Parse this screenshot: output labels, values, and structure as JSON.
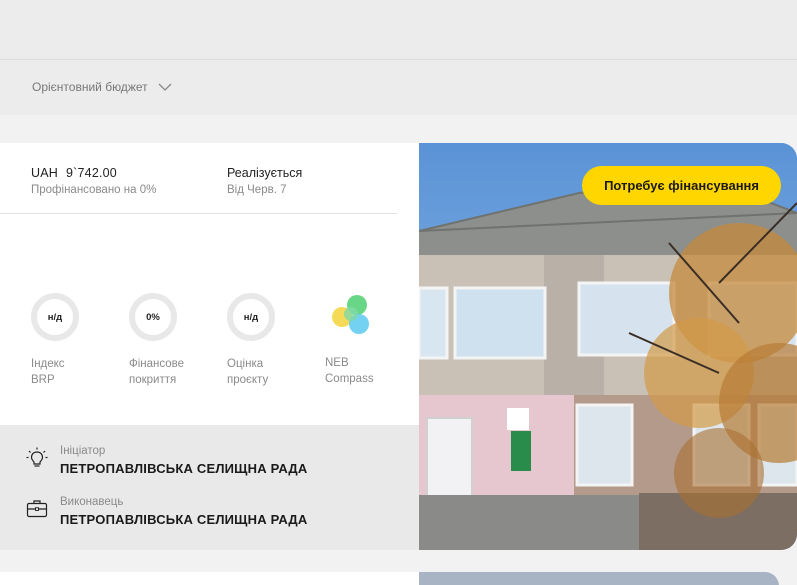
{
  "filter": {
    "budget_label": "Орієнтовний бюджет"
  },
  "project": {
    "currency": "UAH",
    "amount": "9`742.00",
    "financed": "Профінансовано на 0%",
    "status": "Реалізується",
    "status_since": "Від Черв. 7",
    "badge": "Потребує фінансування",
    "metrics": [
      {
        "value": "н/д",
        "label_1": "Індекс",
        "label_2": "BRP"
      },
      {
        "value": "0%",
        "label_1": "Фінансове",
        "label_2": "покриття"
      },
      {
        "value": "н/д",
        "label_1": "Оцінка",
        "label_2": "проєкту"
      }
    ],
    "neb": {
      "label_1": "NEB",
      "label_2": "Compass"
    },
    "initiator": {
      "role": "Ініціатор",
      "org": "ПЕТРОПАВЛІВСЬКА СЕЛИЩНА РАДА"
    },
    "executor": {
      "role": "Виконавець",
      "org": "ПЕТРОПАВЛІВСЬКА СЕЛИЩНА РАДА"
    }
  },
  "colors": {
    "badge": "#ffd600",
    "sky": "#6b9fd8"
  },
  "icons": [
    "chevron-down-icon",
    "lightbulb-icon",
    "briefcase-icon",
    "neb-compass-logo"
  ]
}
